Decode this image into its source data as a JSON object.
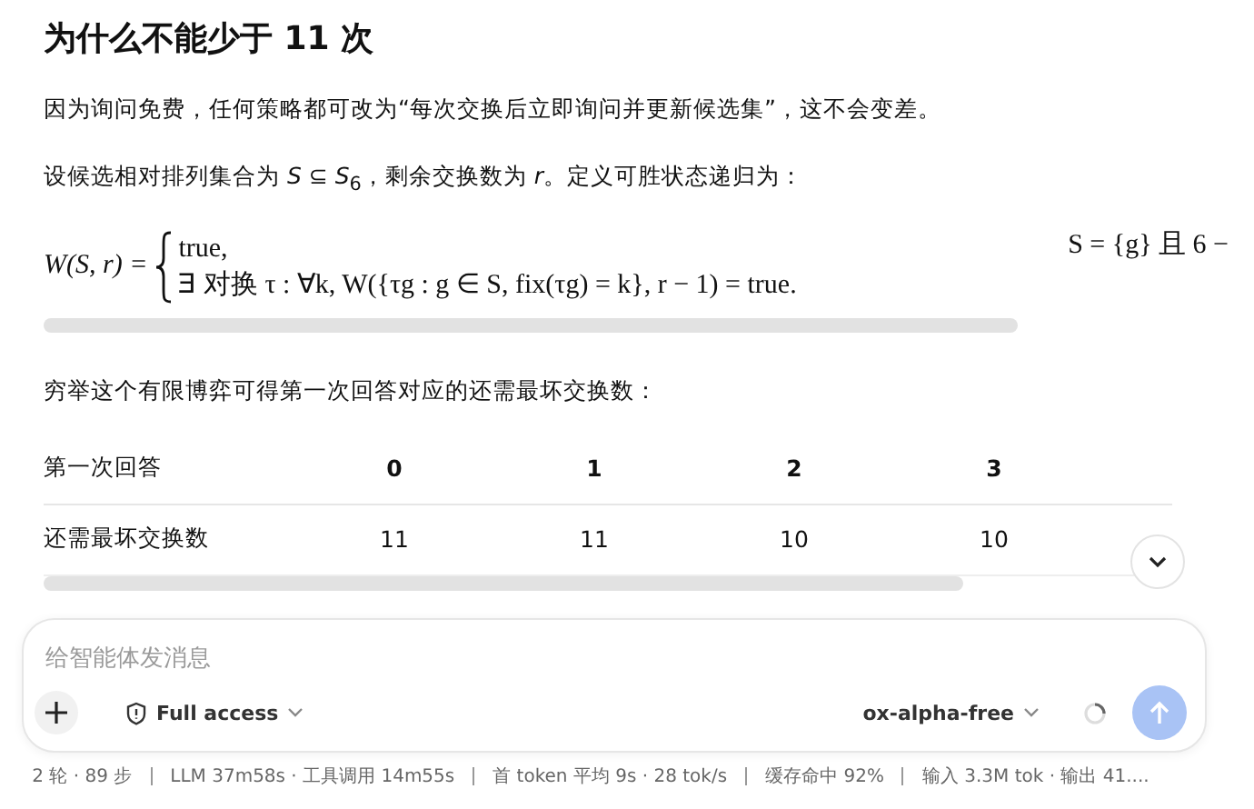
{
  "heading": "为什么不能少于 11 次",
  "intro": "因为询问免费，任何策略都可改为“每次交换后立即询问并更新候选集”，这不会变差。",
  "definition": "设候选相对排列集合为 *S* ⊆ *S*$_{6}$，剩余交换数为 *r*。定义可胜状态递归为：",
  "formula": {
    "lhs": "W(S, r) =",
    "case_1": "true,",
    "case_2": "∃ 对换 τ : ∀k, W({τg : g ∈ S, fix(τg) = k}, r − 1) = true.",
    "condition_1": "S = {g} 且 6 −"
  },
  "table_intro": "穷举这个有限博弈可得第一次回答对应的还需最坏交换数：",
  "table": {
    "columns": [
      "第一次回答",
      "0",
      "1",
      "2",
      "3"
    ],
    "rows": [
      [
        "还需最坏交换数",
        "11",
        "11",
        "10",
        "10"
      ]
    ]
  },
  "composer": {
    "placeholder": "给智能体发消息",
    "access": "Full access",
    "model": "ox-alpha-free"
  },
  "status": [
    "2 轮 · 89 步",
    "LLM 37m58s · 工具调用 14m55s",
    "首 token 平均 9s · 28 tok/s",
    "缓存命中 92%",
    "输入 3.3M tok · 输出 41...."
  ]
}
